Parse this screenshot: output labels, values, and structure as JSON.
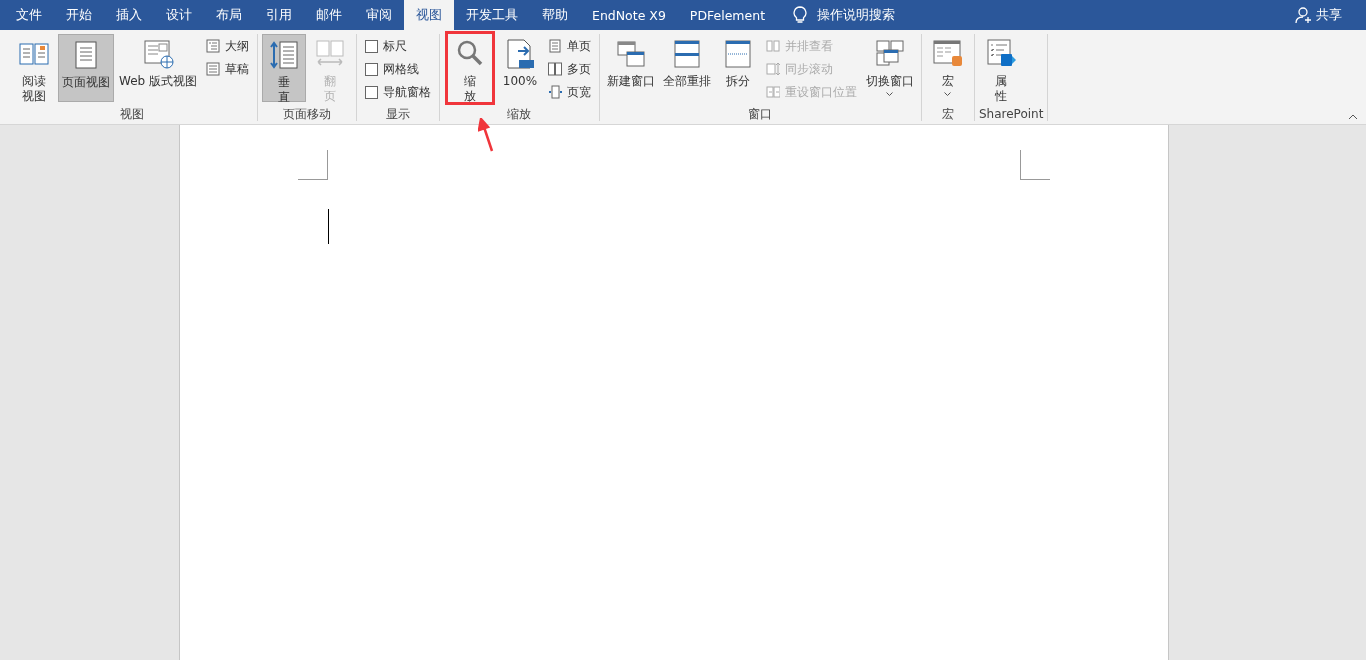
{
  "tabs": [
    {
      "label": "文件",
      "selected": false
    },
    {
      "label": "开始",
      "selected": false
    },
    {
      "label": "插入",
      "selected": false
    },
    {
      "label": "设计",
      "selected": false
    },
    {
      "label": "布局",
      "selected": false
    },
    {
      "label": "引用",
      "selected": false
    },
    {
      "label": "邮件",
      "selected": false
    },
    {
      "label": "审阅",
      "selected": false
    },
    {
      "label": "视图",
      "selected": true
    },
    {
      "label": "开发工具",
      "selected": false
    },
    {
      "label": "帮助",
      "selected": false
    },
    {
      "label": "EndNote X9",
      "selected": false
    },
    {
      "label": "PDFelement",
      "selected": false
    }
  ],
  "tell_me": "操作说明搜索",
  "share": "共享",
  "groups": [
    {
      "label": "视图",
      "controls": [
        {
          "kind": "large",
          "lines": [
            "阅读",
            "视图"
          ],
          "selected": false
        },
        {
          "kind": "large",
          "lines": [
            "页面视图"
          ],
          "selected": true
        },
        {
          "kind": "large",
          "lines": [
            "Web 版式视图"
          ],
          "selected": false
        },
        {
          "kind": "stack",
          "items": [
            {
              "label": "大纲",
              "disabled": false
            },
            {
              "label": "草稿",
              "disabled": false
            }
          ]
        }
      ]
    },
    {
      "label": "页面移动",
      "controls": [
        {
          "kind": "large",
          "lines": [
            "垂",
            "直"
          ],
          "selected": true
        },
        {
          "kind": "large",
          "lines": [
            "翻",
            "页"
          ],
          "selected": false,
          "disabled": true
        }
      ]
    },
    {
      "label": "显示",
      "controls": [
        {
          "kind": "checks",
          "items": [
            {
              "label": "标尺",
              "checked": false
            },
            {
              "label": "网格线",
              "checked": false
            },
            {
              "label": "导航窗格",
              "checked": false
            }
          ]
        }
      ]
    },
    {
      "label": "缩放",
      "controls": [
        {
          "kind": "large",
          "lines": [
            "缩",
            "放"
          ],
          "selected": false,
          "highlighted": true
        },
        {
          "kind": "large",
          "lines": [
            "100%"
          ],
          "selected": false
        },
        {
          "kind": "stack",
          "items": [
            {
              "label": "单页",
              "disabled": false
            },
            {
              "label": "多页",
              "disabled": false
            },
            {
              "label": "页宽",
              "disabled": false
            }
          ]
        }
      ]
    },
    {
      "label": "窗口",
      "controls": [
        {
          "kind": "large",
          "lines": [
            "新建窗口"
          ],
          "selected": false
        },
        {
          "kind": "large",
          "lines": [
            "全部重排"
          ],
          "selected": false
        },
        {
          "kind": "large",
          "lines": [
            "拆分"
          ],
          "selected": false
        },
        {
          "kind": "stack",
          "items": [
            {
              "label": "并排查看",
              "disabled": true
            },
            {
              "label": "同步滚动",
              "disabled": true
            },
            {
              "label": "重设窗口位置",
              "disabled": true
            }
          ]
        },
        {
          "kind": "large",
          "lines": [
            "切换窗口"
          ],
          "selected": false,
          "dropdown": true
        }
      ]
    },
    {
      "label": "宏",
      "controls": [
        {
          "kind": "large",
          "lines": [
            "宏"
          ],
          "selected": false,
          "dropdown": true
        }
      ]
    },
    {
      "label": "SharePoint",
      "controls": [
        {
          "kind": "large",
          "lines": [
            "属",
            "性"
          ],
          "selected": false
        }
      ]
    }
  ]
}
